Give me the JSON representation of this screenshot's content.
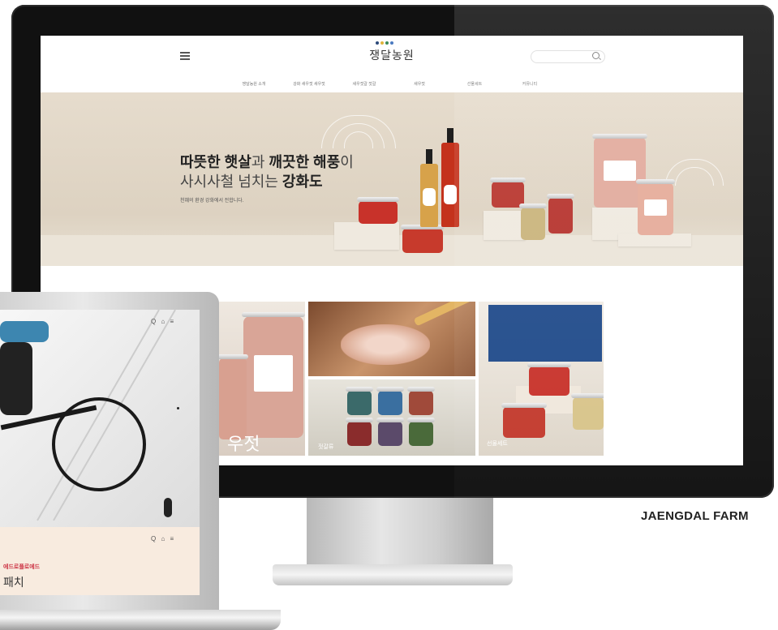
{
  "caption": "JAENGDAL FARM",
  "site": {
    "logo_text": "쟁달농원",
    "logo_dot_colors": [
      "#2c4a7a",
      "#e0b43a",
      "#3a8a5a",
      "#4a7ac0"
    ],
    "nav_items": [
      "쟁달농원 소개",
      "강화 새우젓 새우젓",
      "새우젓갈 젓갈",
      "새우젓",
      "선물세트",
      "커뮤니티"
    ],
    "hero": {
      "line1_bold": "따뜻한 햇살",
      "line1_mid": "과 ",
      "line1_bold2": "깨끗한 해풍",
      "line1_end": "이",
      "line2_light": "사시사철 넘치는 ",
      "line2_bold": "강화도",
      "subtitle": "천혜의 환경 강화에서 전합니다."
    },
    "tiles": {
      "shrimp_jar_caption": "우젓",
      "jeotgal_caption": "젓갈류",
      "gift_caption": "선물세트"
    }
  },
  "laptop": {
    "top_icons": "Q ⌂ ≡",
    "panel_icons": "Q ⌂ ≡",
    "panel_small_text": "에드로플로에드",
    "panel_big_text": "패치"
  },
  "colors": {
    "bezel": "#111111",
    "hero_bg": "#e2d8c8",
    "accent_red": "#c8322a",
    "gift_box_blue": "#1f4a8a"
  }
}
